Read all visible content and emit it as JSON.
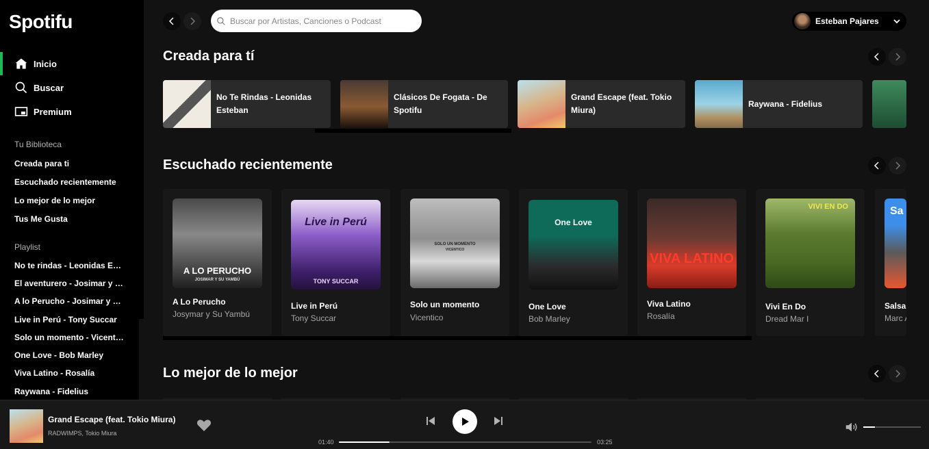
{
  "app": {
    "name": "Spotifu"
  },
  "nav": [
    {
      "label": "Inicio",
      "icon": "home-icon",
      "active": true
    },
    {
      "label": "Buscar",
      "icon": "search-icon",
      "active": false
    },
    {
      "label": "Premium",
      "icon": "premium-icon",
      "active": false
    }
  ],
  "library": {
    "heading": "Tu Biblioteca",
    "items": [
      "Creada para ti",
      "Escuchado recientemente",
      "Lo mejor de lo mejor",
      "Tus Me Gusta"
    ]
  },
  "playlists": {
    "heading": "Playlist",
    "items": [
      "No te rindas - Leonidas Esteban",
      "El aventurero - Josimar y su Yambú",
      "A lo Perucho - Josimar y su Yambú",
      "Live in Perú - Tony Succar",
      "Solo un momento - Vicentico",
      "One Love - Bob Marley",
      "Viva Latino - Rosalía",
      "Raywana - Fidelius"
    ]
  },
  "search": {
    "placeholder": "Buscar por Artistas, Canciones o Podcast"
  },
  "user": {
    "name": "Esteban Pajares"
  },
  "sections": {
    "made_for_you": {
      "title": "Creada para tí",
      "cards": [
        {
          "title": "No Te Rindas - Leonidas Esteban",
          "cover_colors": [
            "#e9e5de",
            "#333"
          ]
        },
        {
          "title": "Clásicos De Fogata - De Spotifu",
          "cover_colors": [
            "#a36a3b",
            "#2d1b12"
          ]
        },
        {
          "title": "Grand Escape (feat. Tokio Miura)",
          "cover_colors": [
            "#9fd2e8",
            "#e8a050"
          ]
        },
        {
          "title": "Raywana - Fidelius",
          "cover_colors": [
            "#6fb6d4",
            "#c9a46b"
          ]
        }
      ]
    },
    "recent": {
      "title": "Escuchado recientemente",
      "cards": [
        {
          "title": "A Lo Perucho",
          "artist": "Josymar y Su Yambú",
          "cover_text": "A LO PERUCHO",
          "cover_sub": "JOSIMAR Y SU YAMBÚ"
        },
        {
          "title": "Live in Perú",
          "artist": "Tony Succar",
          "cover_text": "Live in Perú",
          "cover_sub": "TONY SUCCAR"
        },
        {
          "title": "Solo un momento",
          "artist": "Vicentico",
          "cover_text": "SOLO UN MOMENTO",
          "cover_sub": "VICENTICO"
        },
        {
          "title": "One Love",
          "artist": "Bob Marley",
          "cover_text": "One Love",
          "cover_sub": ""
        },
        {
          "title": "Viva Latino",
          "artist": "Rosalía",
          "cover_text": "VIVA LATINO",
          "cover_sub": ""
        },
        {
          "title": "Vivi En Do",
          "artist": "Dread Mar I",
          "cover_text": "VIVI EN DO",
          "cover_sub": ""
        },
        {
          "title": "Salsa",
          "artist": "Marc A",
          "cover_text": "Sa",
          "cover_sub": ""
        }
      ]
    },
    "best": {
      "title": "Lo mejor de lo mejor"
    }
  },
  "player": {
    "title": "Grand Escape (feat. Tokio Miura)",
    "artist": "RADWIMPS, Tokio Miura",
    "elapsed": "01:40",
    "duration": "03:25",
    "progress": 0.2,
    "volume": 0.2
  },
  "colors": {
    "accent": "#1db954",
    "bg": "#121212",
    "card": "#181818"
  }
}
